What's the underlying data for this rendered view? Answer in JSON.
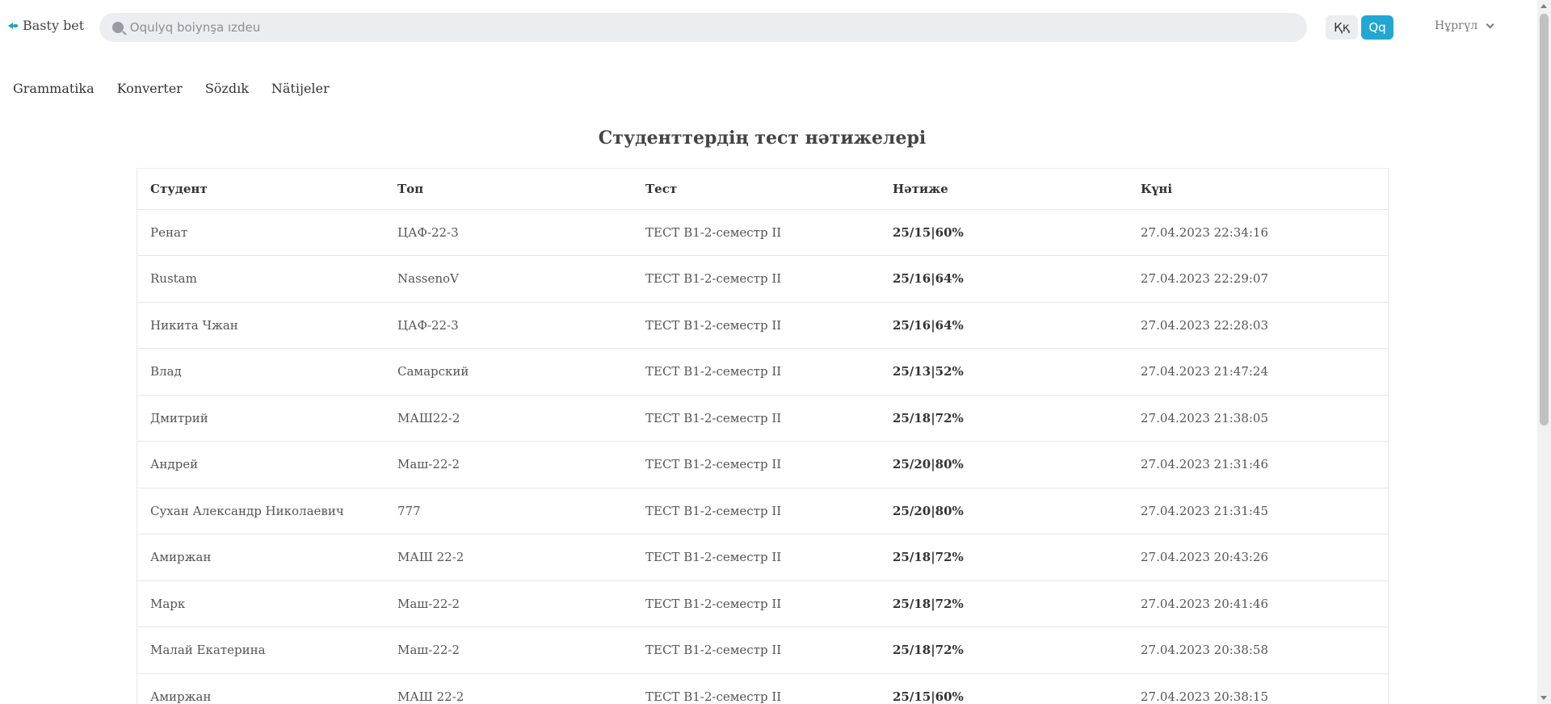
{
  "header": {
    "logo_text": "Basty bet",
    "search_placeholder": "Oqulyq boiynşa ızdeu",
    "alphabet": {
      "cyrillic": "Ққ",
      "latin": "Qq"
    },
    "user_name": "Нұргүл"
  },
  "nav": [
    {
      "label": "Grammatika"
    },
    {
      "label": "Konverter"
    },
    {
      "label": "Sözdık"
    },
    {
      "label": "Nätijeler"
    }
  ],
  "page_title": "Студенттердің тест нәтижелері",
  "table": {
    "headers": [
      "Студент",
      "Топ",
      "Тест",
      "Нәтиже",
      "Күні"
    ],
    "rows": [
      {
        "student": "Ренат",
        "group": "ЦАФ-22-3",
        "test": "ТЕСТ B1-2-семестр II",
        "result": "25/15|60%",
        "date": "27.04.2023 22:34:16"
      },
      {
        "student": "Rustam",
        "group": "NassenoV",
        "test": "ТЕСТ B1-2-семестр II",
        "result": "25/16|64%",
        "date": "27.04.2023 22:29:07"
      },
      {
        "student": "Никита Чжан",
        "group": "ЦАФ-22-3",
        "test": "ТЕСТ B1-2-семестр II",
        "result": "25/16|64%",
        "date": "27.04.2023 22:28:03"
      },
      {
        "student": "Влад",
        "group": "Самарский",
        "test": "ТЕСТ B1-2-семестр II",
        "result": "25/13|52%",
        "date": "27.04.2023 21:47:24"
      },
      {
        "student": "Дмитрий",
        "group": "МАШ22-2",
        "test": "ТЕСТ B1-2-семестр II",
        "result": "25/18|72%",
        "date": "27.04.2023 21:38:05"
      },
      {
        "student": "Андрей",
        "group": "Маш-22-2",
        "test": "ТЕСТ B1-2-семестр II",
        "result": "25/20|80%",
        "date": "27.04.2023 21:31:46"
      },
      {
        "student": "Сухан Александр Николаевич",
        "group": "777",
        "test": "ТЕСТ B1-2-семестр II",
        "result": "25/20|80%",
        "date": "27.04.2023 21:31:45"
      },
      {
        "student": "Амиржан",
        "group": "МАШ 22-2",
        "test": "ТЕСТ B1-2-семестр II",
        "result": "25/18|72%",
        "date": "27.04.2023 20:43:26"
      },
      {
        "student": "Марк",
        "group": "Маш-22-2",
        "test": "ТЕСТ B1-2-семестр II",
        "result": "25/18|72%",
        "date": "27.04.2023 20:41:46"
      },
      {
        "student": "Малай Екатерина",
        "group": "Маш-22-2",
        "test": "ТЕСТ B1-2-семестр II",
        "result": "25/18|72%",
        "date": "27.04.2023 20:38:58"
      },
      {
        "student": "Амиржан",
        "group": "МАШ 22-2",
        "test": "ТЕСТ B1-2-семестр II",
        "result": "25/15|60%",
        "date": "27.04.2023 20:38:15"
      }
    ]
  },
  "colors": {
    "accent": "#22a7d1",
    "search_bg": "#ecedf1",
    "border": "#e6e6e6"
  }
}
